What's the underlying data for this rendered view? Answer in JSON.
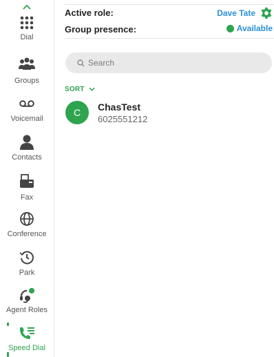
{
  "colors": {
    "accent_green": "#2ea44f",
    "link_blue": "#2a8fd8"
  },
  "sidebar": {
    "collapse_icon": "chevron-up-icon",
    "items": [
      {
        "label": "Dial",
        "icon": "dialpad-icon"
      },
      {
        "label": "Groups",
        "icon": "groups-icon"
      },
      {
        "label": "Voicemail",
        "icon": "voicemail-icon"
      },
      {
        "label": "Contacts",
        "icon": "contact-icon"
      },
      {
        "label": "Fax",
        "icon": "fax-icon"
      },
      {
        "label": "Conference",
        "icon": "conference-icon"
      },
      {
        "label": "Park",
        "icon": "park-icon"
      },
      {
        "label": "Agent Roles",
        "icon": "agent-headset-icon"
      },
      {
        "label": "Speed Dial",
        "icon": "speed-dial-icon",
        "active": true
      }
    ]
  },
  "header": {
    "active_role_label": "Active role:",
    "active_role_value": "Dave Tate",
    "group_presence_label": "Group presence:",
    "group_presence_value": "Available"
  },
  "search": {
    "placeholder": "Search"
  },
  "sort": {
    "label": "SORT"
  },
  "contacts": [
    {
      "initial": "C",
      "name": "ChasTest",
      "number": "6025551212"
    }
  ]
}
